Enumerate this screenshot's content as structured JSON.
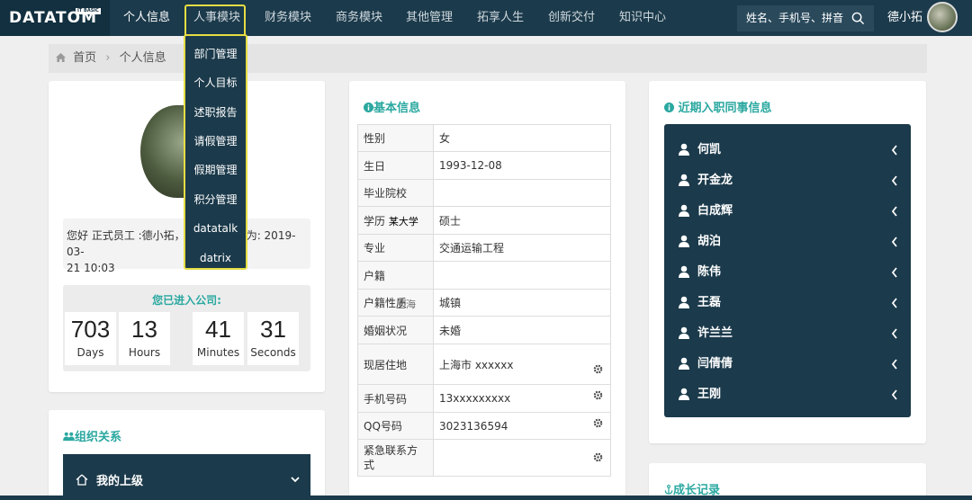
{
  "header": {
    "logo": "DATATOM",
    "logo_tag": "IT BASIC",
    "nav": [
      "个人信息",
      "人事模块",
      "财务模块",
      "商务模块",
      "其他管理",
      "拓享人生",
      "创新交付",
      "知识中心"
    ],
    "search_placeholder": "姓名、手机号、拼音",
    "user_name": "德小拓"
  },
  "breadcrumb": {
    "home": "首页",
    "current": "个人信息"
  },
  "dropdown": [
    "部门管理",
    "个人目标",
    "述职报告",
    "请假管理",
    "假期管理",
    "积分管理",
    "datatalk",
    "datrix"
  ],
  "profile": {
    "greeting_line1": "您好 正式员工 :德小拓，",
    "greeting_line1_tail": "为: 2019-03-",
    "greeting_line2": "21 10:03",
    "timer_title": "您已进入公司:",
    "timer": [
      {
        "value": "703",
        "label": "Days"
      },
      {
        "value": "13",
        "label": "Hours"
      },
      {
        "value": "41",
        "label": "Minutes"
      },
      {
        "value": "31",
        "label": "Seconds"
      }
    ]
  },
  "org": {
    "title": "组织关系",
    "my_superior": "我的上级"
  },
  "basic_info": {
    "title": "基本信息",
    "rows": [
      {
        "k": "性别",
        "v": "女"
      },
      {
        "k": "生日",
        "v": "1993-12-08"
      },
      {
        "k": "毕业院校",
        "v": ""
      },
      {
        "k": "学历",
        "k_extra": "某大学",
        "v": "硕士"
      },
      {
        "k": "专业",
        "v": "交通运输工程"
      },
      {
        "k": "户籍",
        "v": ""
      },
      {
        "k": "户籍性质",
        "k_overlay": "上海",
        "v": "城镇"
      },
      {
        "k": "婚姻状况",
        "v": "未婚"
      },
      {
        "k": "现居住地",
        "v": "上海市 xxxxxx"
      },
      {
        "k": "手机号码",
        "v": "13xxxxxxxxx"
      },
      {
        "k": "QQ号码",
        "v": "3023136594"
      },
      {
        "k": "紧急联系方式",
        "v": ""
      }
    ]
  },
  "colleagues": {
    "title": "近期入职同事信息",
    "names": [
      "何凯",
      "开金龙",
      "白成辉",
      "胡泊",
      "陈伟",
      "王磊",
      "许兰兰",
      "闫倩倩",
      "王刚"
    ]
  },
  "growth": {
    "title": "成长记录"
  },
  "colors": {
    "navy": "#1b3a4b",
    "teal": "#2aa8a0",
    "highlight": "#e6dd44"
  }
}
